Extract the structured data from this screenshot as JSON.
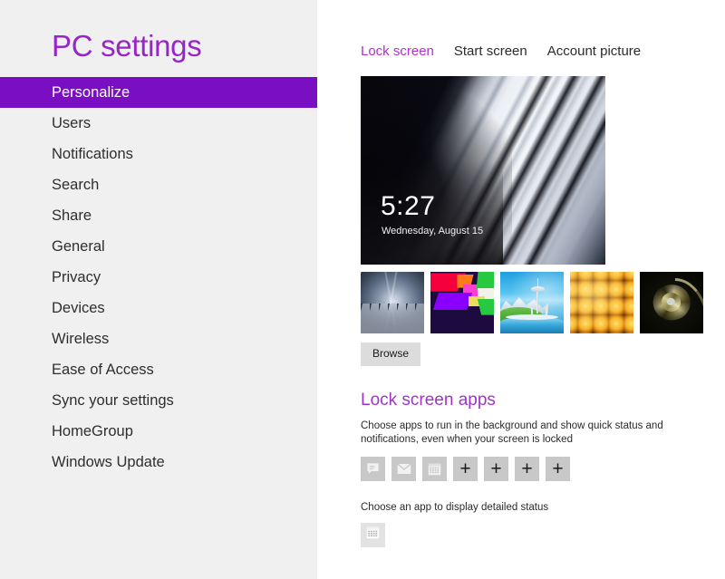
{
  "sidebar": {
    "title": "PC settings",
    "items": [
      {
        "label": "Personalize",
        "selected": true
      },
      {
        "label": "Users",
        "selected": false
      },
      {
        "label": "Notifications",
        "selected": false
      },
      {
        "label": "Search",
        "selected": false
      },
      {
        "label": "Share",
        "selected": false
      },
      {
        "label": "General",
        "selected": false
      },
      {
        "label": "Privacy",
        "selected": false
      },
      {
        "label": "Devices",
        "selected": false
      },
      {
        "label": "Wireless",
        "selected": false
      },
      {
        "label": "Ease of Access",
        "selected": false
      },
      {
        "label": "Sync your settings",
        "selected": false
      },
      {
        "label": "HomeGroup",
        "selected": false
      },
      {
        "label": "Windows Update",
        "selected": false
      }
    ]
  },
  "main": {
    "tabs": [
      {
        "label": "Lock screen",
        "active": true
      },
      {
        "label": "Start screen",
        "active": false
      },
      {
        "label": "Account picture",
        "active": false
      }
    ],
    "lock_preview": {
      "image_name": "piano-keys-wallpaper",
      "time": "5:27",
      "date": "Wednesday, August 15"
    },
    "thumbnails": [
      {
        "name": "escalator-tunnel-wallpaper",
        "selected": true
      },
      {
        "name": "abstract-geometric-wallpaper",
        "selected": false
      },
      {
        "name": "space-needle-wallpaper",
        "selected": false
      },
      {
        "name": "honeycomb-wallpaper",
        "selected": false
      },
      {
        "name": "nautilus-shell-wallpaper",
        "selected": false
      }
    ],
    "browse_label": "Browse",
    "lock_screen_apps": {
      "heading": "Lock screen apps",
      "description": "Choose apps to run in the background and show quick status and notifications, even when your screen is locked",
      "apps": [
        {
          "icon": "messaging-icon",
          "type": "app"
        },
        {
          "icon": "mail-icon",
          "type": "app"
        },
        {
          "icon": "calendar-icon",
          "type": "app"
        },
        {
          "icon": "plus-icon",
          "type": "add",
          "label": "+"
        },
        {
          "icon": "plus-icon",
          "type": "add",
          "label": "+"
        },
        {
          "icon": "plus-icon",
          "type": "add",
          "label": "+"
        },
        {
          "icon": "plus-icon",
          "type": "add",
          "label": "+"
        }
      ],
      "detailed_status_label": "Choose an app to display detailed status",
      "detailed_status_app": {
        "icon": "calendar-icon"
      }
    }
  },
  "colors": {
    "accent_purple": "#7a0ec2",
    "title_purple": "#9725c8",
    "heading_purple": "#a233c8",
    "tab_active": "#b32ed0",
    "sidebar_bg": "#f0f0f0",
    "main_bg": "#ffffff",
    "tile_bg": "#c8c8c8",
    "browse_bg": "#dcdcdc"
  }
}
